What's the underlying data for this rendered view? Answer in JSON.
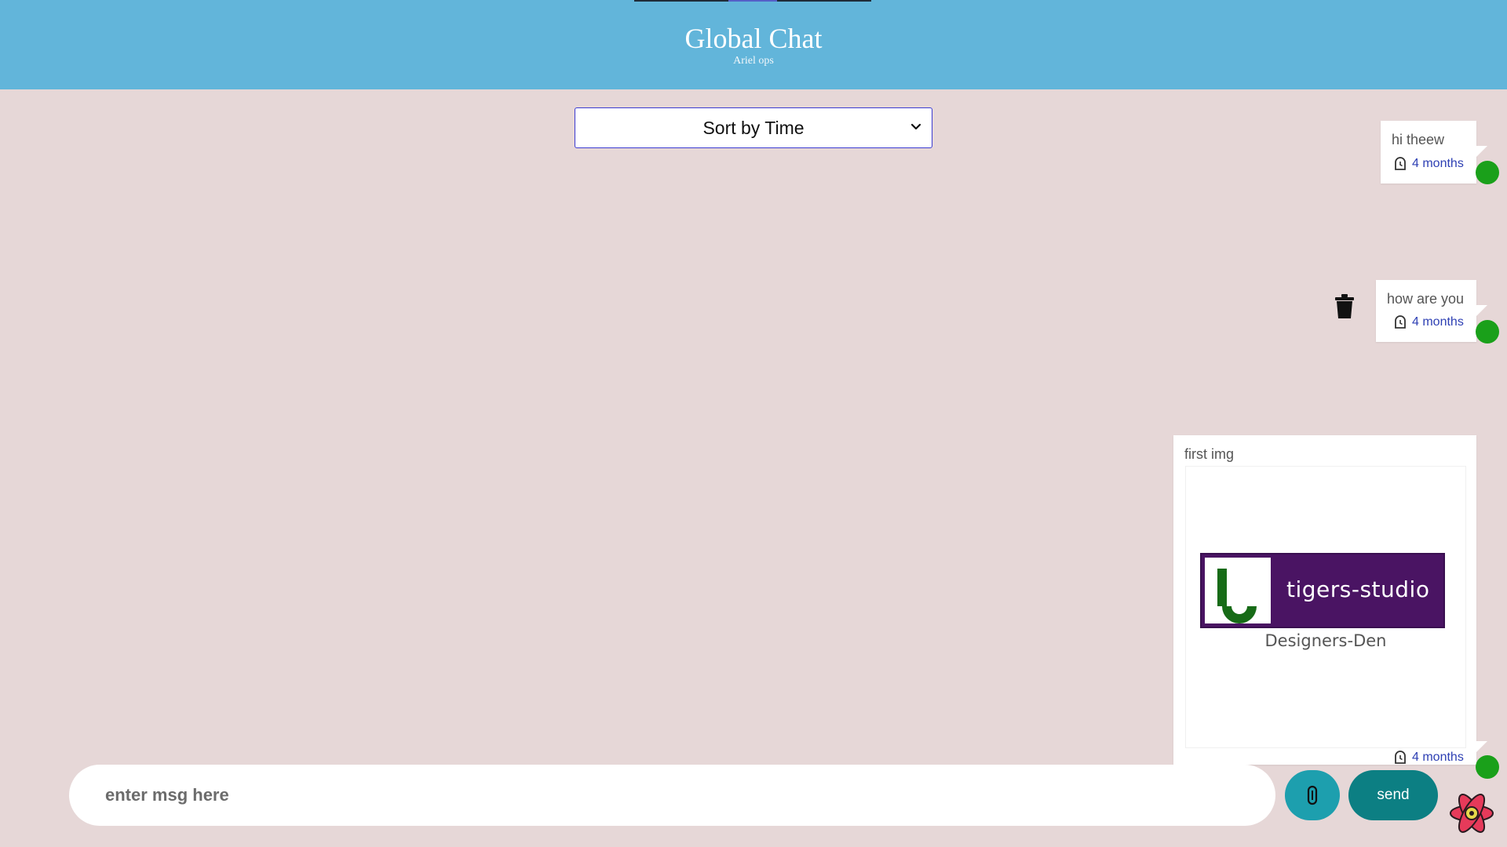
{
  "header": {
    "title": "Global Chat",
    "subtitle": "Ariel ops"
  },
  "sort": {
    "selected": "Sort by Time"
  },
  "messages": [
    {
      "text": "hi theew",
      "time": "4 months"
    },
    {
      "text": "how are you",
      "time": "4 months"
    },
    {
      "text": "first img",
      "time": "4 months",
      "image": {
        "brand": "tigers-studio",
        "caption": "Designers-Den"
      }
    }
  ],
  "composer": {
    "placeholder": "enter msg here",
    "send_label": "send"
  },
  "colors": {
    "header": "#62b5da",
    "background": "#e6d7d7",
    "online_dot": "#1aa01a",
    "send_button": "#0c7f83",
    "attach_button": "#1d9fae",
    "time_text": "#2d3fb3"
  },
  "icons": [
    "chevron-down-icon",
    "clock-icon",
    "trash-icon",
    "paperclip-icon",
    "react-logo-icon"
  ]
}
